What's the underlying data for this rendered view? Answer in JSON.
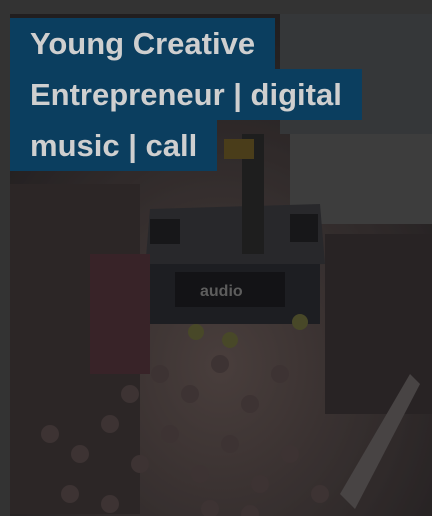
{
  "card": {
    "title_lines": [
      "Young Creative",
      "Entrepreneur | digital",
      "music | call"
    ]
  },
  "photo": {
    "scene": "outdoor-concert-crowd",
    "sign_text": "audio"
  },
  "colors": {
    "title_bg": "#0b3e5f",
    "title_text": "#cfcfcf",
    "overlay": "#3a3a3a"
  }
}
